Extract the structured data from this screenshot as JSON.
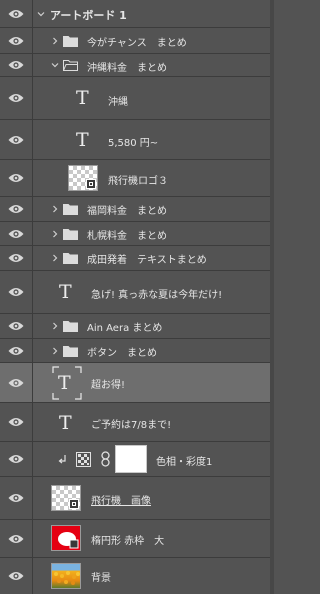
{
  "panel": {
    "artboard_label": "アートボード 1",
    "layers": [
      {
        "label": "今がチャンス　まとめ"
      },
      {
        "label": "沖縄料金　まとめ"
      },
      {
        "label": "沖縄"
      },
      {
        "label": "5,580 円~"
      },
      {
        "label": "飛行機ロゴ３"
      },
      {
        "label": "福岡料金　まとめ"
      },
      {
        "label": "札幌料金　まとめ"
      },
      {
        "label": "成田発着　テキストまとめ"
      },
      {
        "label": "急げ! 真っ赤な夏は今年だけ!"
      },
      {
        "label": "Ain Aera まとめ"
      },
      {
        "label": "ボタン　まとめ"
      },
      {
        "label": "超お得!"
      },
      {
        "label": "ご予約は7/8まで!"
      },
      {
        "label": "色相・彩度1"
      },
      {
        "label": "飛行機　画像"
      },
      {
        "label": "楕円形 赤枠　大"
      },
      {
        "label": "背景"
      }
    ],
    "type_icon": "T"
  },
  "icons": {
    "visibility": "eye-icon",
    "expand": "chevron-right-icon",
    "collapse": "chevron-down-icon",
    "group": "folder-icon",
    "open_group": "folder-open-icon",
    "type_layer": "type-layer-icon",
    "clip": "clipping-arrow-icon",
    "adjustment": "adjustment-layer-icon",
    "link": "link-icon",
    "smart_object": "smart-object-badge-icon"
  },
  "colors": {
    "panel_bg": "#535353",
    "row_selected": "#6e6e6e",
    "divider": "#3c3c3c",
    "text": "#e6e6e6",
    "ellipse_red": "#e50012"
  }
}
